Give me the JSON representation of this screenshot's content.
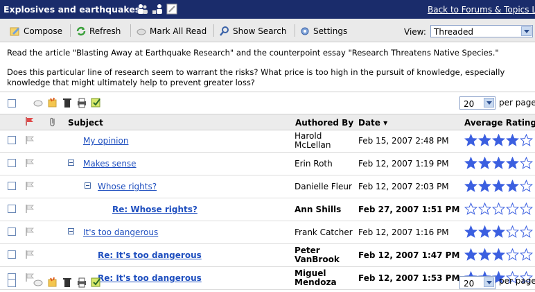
{
  "title": "Explosives and earthquakes",
  "back_link": "Back to Forums & Topics Lis",
  "toolbar": {
    "compose": "Compose",
    "refresh": "Refresh",
    "mark_all_read": "Mark All Read",
    "show_search": "Show Search",
    "settings": "Settings",
    "view_label": "View:",
    "view_value": "Threaded"
  },
  "instructions": {
    "line1": "Read the article \"Blasting Away at Earthquake Research\" and the counterpoint essay \"Research Threatens Native Species.\"",
    "line2": "Does this particular line of research seem to warrant the risks? What price is too high in the pursuit of knowledge, especially knowledge that might ultimately help to prevent greater loss?"
  },
  "per_page": {
    "value": "20",
    "label": "per page"
  },
  "columns": {
    "subject": "Subject",
    "authored_by": "Authored By",
    "date": "Date ▾",
    "average_rating": "Average Rating"
  },
  "colors": {
    "titlebar": "#1a2c6b",
    "link": "#1f4fbf",
    "star_fill": "#3b5fe0"
  },
  "posts": [
    {
      "subject": "My opinion",
      "author": "Harold McLellan",
      "date": "Feb 15, 2007 2:48 PM",
      "rating": 4,
      "unread": false,
      "indent": 0,
      "expander": false
    },
    {
      "subject": "Makes sense",
      "author": "Erin Roth",
      "date": "Feb 12, 2007 1:19 PM",
      "rating": 4,
      "unread": false,
      "indent": 0,
      "expander": true
    },
    {
      "subject": "Whose rights?",
      "author": "Danielle Fleur",
      "date": "Feb 12, 2007 2:03 PM",
      "rating": 4,
      "unread": false,
      "indent": 1,
      "expander": true
    },
    {
      "subject": "Re: Whose rights?",
      "author": "Ann Shills",
      "date": "Feb 27, 2007 1:51 PM",
      "rating": 0,
      "unread": true,
      "indent": 2,
      "expander": false
    },
    {
      "subject": "It's too dangerous",
      "author": "Frank Catcher",
      "date": "Feb 12, 2007 1:16 PM",
      "rating": 3,
      "unread": false,
      "indent": 0,
      "expander": true
    },
    {
      "subject": "Re: It's too dangerous",
      "author": "Peter VanBrook",
      "date": "Feb 12, 2007 1:47 PM",
      "rating": 3,
      "unread": true,
      "indent": 1,
      "expander": false
    },
    {
      "subject": "Re: It's too dangerous",
      "author": "Miguel Mendoza",
      "date": "Feb 12, 2007 1:53 PM",
      "rating": 3,
      "unread": true,
      "indent": 1,
      "expander": false
    }
  ]
}
